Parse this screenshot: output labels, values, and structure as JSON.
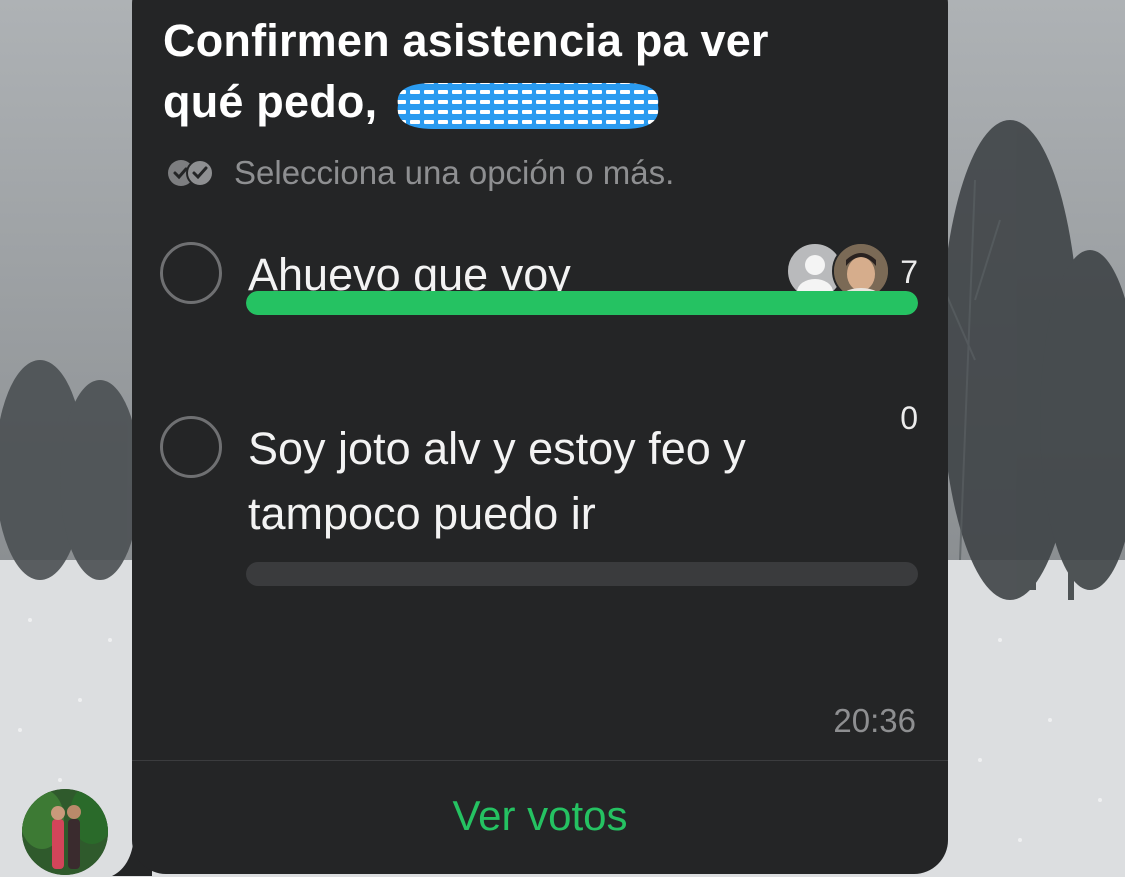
{
  "poll": {
    "question_line1": "Confirmen asistencia pa ver",
    "question_line2": "qué pedo,",
    "hint": "Selecciona una opción o más.",
    "options": [
      {
        "label": "Ahuevo que voy",
        "votes": "7",
        "progress_fraction": 1.0
      },
      {
        "label": "Soy joto alv y estoy feo y tampoco puedo ir",
        "votes": "0",
        "progress_fraction": 0.0
      }
    ],
    "time": "20:36",
    "view_votes_label": "Ver votos"
  },
  "colors": {
    "bubble": "#242526",
    "accent_green": "#25c262",
    "muted_text": "#8e8f91",
    "scribble_blue": "#2a9bf0"
  },
  "icons": {
    "hint_icon": "double-check-icon",
    "radio": "radio-circle-icon"
  }
}
